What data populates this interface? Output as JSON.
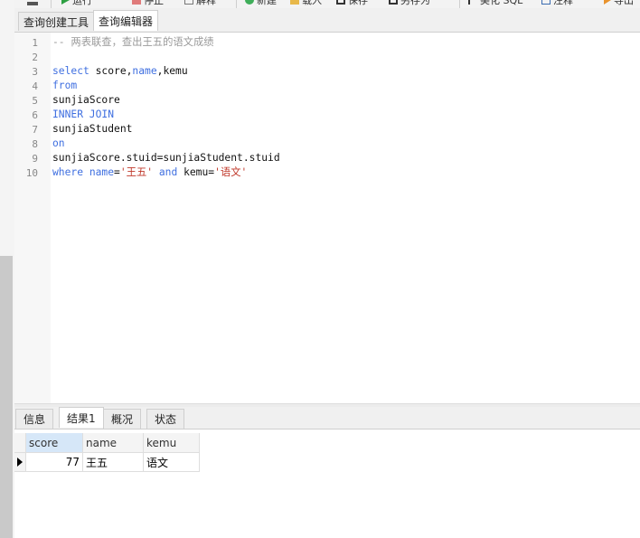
{
  "toolbar": {
    "items": [
      {
        "label": "运行",
        "icon": "run-icon"
      },
      {
        "label": "停止",
        "icon": "stop-icon"
      },
      {
        "label": "解释",
        "icon": "explain-icon"
      },
      {
        "label": "新建",
        "icon": "new-icon"
      },
      {
        "label": "载入",
        "icon": "load-icon"
      },
      {
        "label": "保存",
        "icon": "save-icon"
      },
      {
        "label": "另存为",
        "icon": "save-as-icon"
      },
      {
        "label": "美化 SQL",
        "icon": "beautify-icon"
      },
      {
        "label": "注释",
        "icon": "comment-icon"
      },
      {
        "label": "导出",
        "icon": "export-icon"
      }
    ]
  },
  "editor_tabs": {
    "builder": "查询创建工具",
    "editor": "查询编辑器"
  },
  "editor": {
    "line_numbers": [
      "1",
      "2",
      "3",
      "4",
      "5",
      "6",
      "7",
      "8",
      "9",
      "10"
    ],
    "lines": {
      "l1_comment": "-- 两表联查，查出王五的语文成绩",
      "l3_kw": "select",
      "l3_a": " score,",
      "l3_kw2": "name",
      "l3_b": ",kemu",
      "l4_kw": "from",
      "l5": "sunjiaScore",
      "l6_kw": "INNER JOIN",
      "l7": "sunjiaStudent",
      "l8_kw": "on",
      "l9": "sunjiaScore.stuid=sunjiaStudent.stuid",
      "l10_kw1": "where",
      "l10_sp1": " ",
      "l10_kw2": "name",
      "l10_eq1": "=",
      "l10_str1": "'王五'",
      "l10_sp2": " ",
      "l10_kw3": "and",
      "l10_kemu": " kemu=",
      "l10_str2": "'语文'"
    }
  },
  "result_tabs": {
    "info": "信息",
    "result1": "结果1",
    "overview": "概况",
    "status": "状态"
  },
  "result_grid": {
    "columns": [
      "score",
      "name",
      "kemu"
    ],
    "rows": [
      {
        "score": "77",
        "name": "王五",
        "kemu": "语文"
      }
    ]
  },
  "colors": {
    "keyword": "#3f6fe0",
    "string": "#c0392b",
    "comment": "#9a9a9a",
    "selected_header": "#d6e7f8"
  }
}
